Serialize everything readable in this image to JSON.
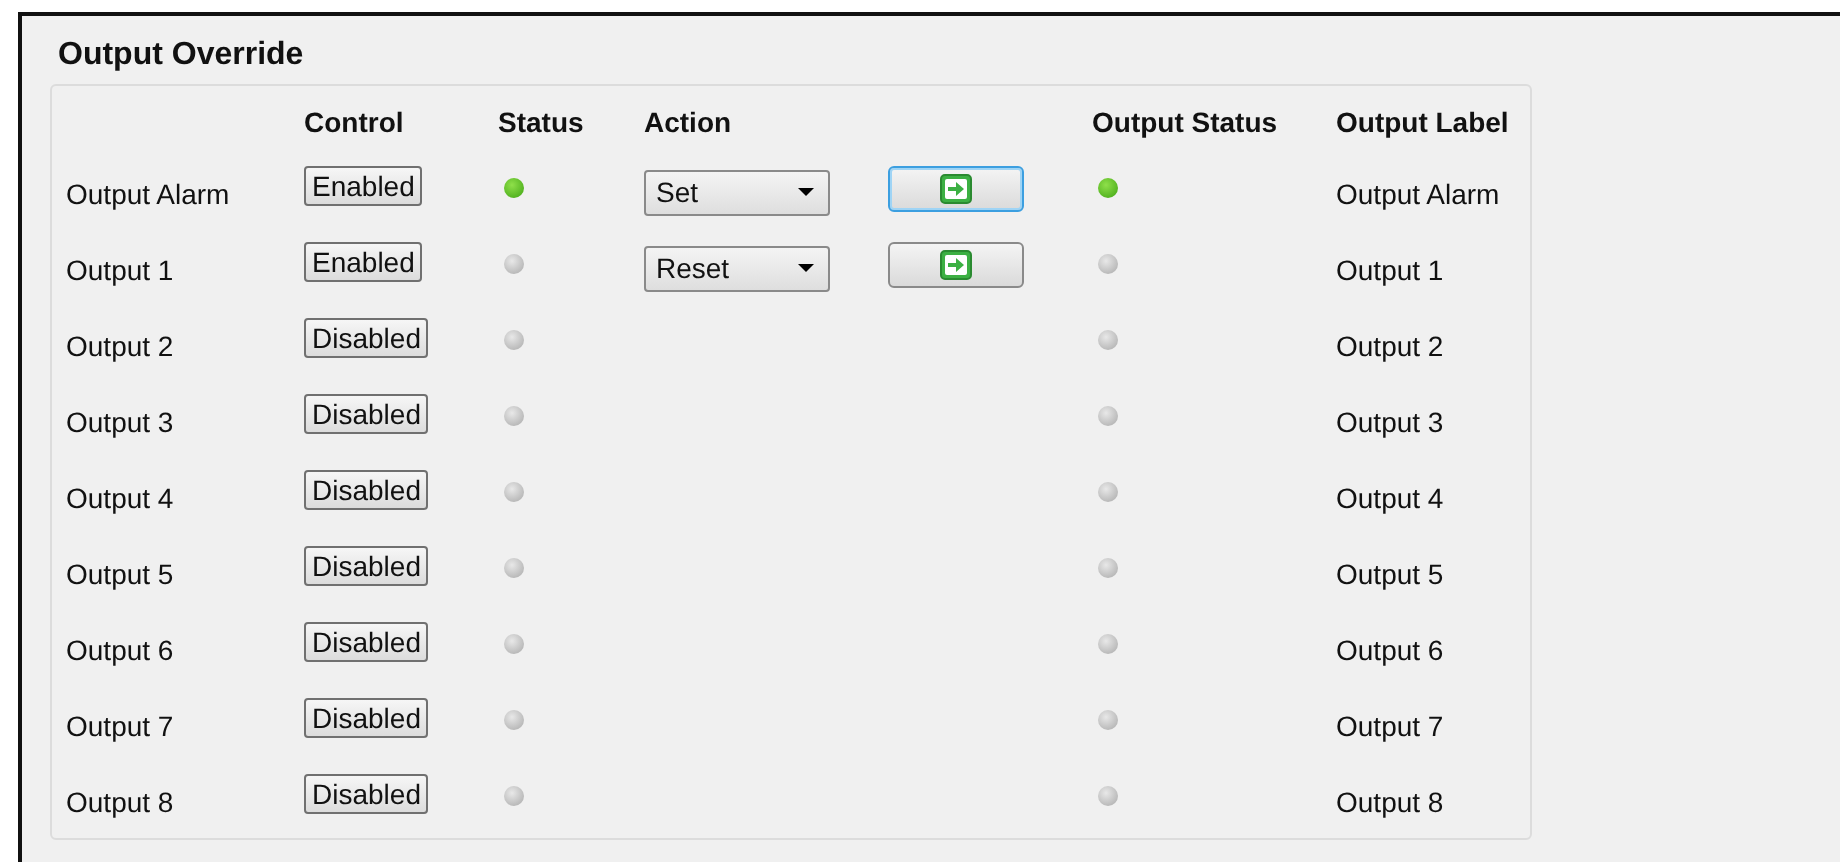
{
  "title": "Output Override",
  "headers": {
    "control": "Control",
    "status": "Status",
    "action": "Action",
    "output_status": "Output Status",
    "output_label": "Output Label"
  },
  "rows": [
    {
      "name": "Output Alarm",
      "control": "Enabled",
      "status_on": true,
      "action": "Set",
      "go_focused": true,
      "output_status_on": true,
      "output_label": "Output Alarm"
    },
    {
      "name": "Output 1",
      "control": "Enabled",
      "status_on": false,
      "action": "Reset",
      "go_focused": false,
      "output_status_on": false,
      "output_label": "Output 1"
    },
    {
      "name": "Output 2",
      "control": "Disabled",
      "status_on": false,
      "output_status_on": false,
      "output_label": "Output 2"
    },
    {
      "name": "Output 3",
      "control": "Disabled",
      "status_on": false,
      "output_status_on": false,
      "output_label": "Output 3"
    },
    {
      "name": "Output 4",
      "control": "Disabled",
      "status_on": false,
      "output_status_on": false,
      "output_label": "Output 4"
    },
    {
      "name": "Output 5",
      "control": "Disabled",
      "status_on": false,
      "output_status_on": false,
      "output_label": "Output 5"
    },
    {
      "name": "Output 6",
      "control": "Disabled",
      "status_on": false,
      "output_status_on": false,
      "output_label": "Output 6"
    },
    {
      "name": "Output 7",
      "control": "Disabled",
      "status_on": false,
      "output_status_on": false,
      "output_label": "Output 7"
    },
    {
      "name": "Output 8",
      "control": "Disabled",
      "status_on": false,
      "output_status_on": false,
      "output_label": "Output 8"
    }
  ]
}
